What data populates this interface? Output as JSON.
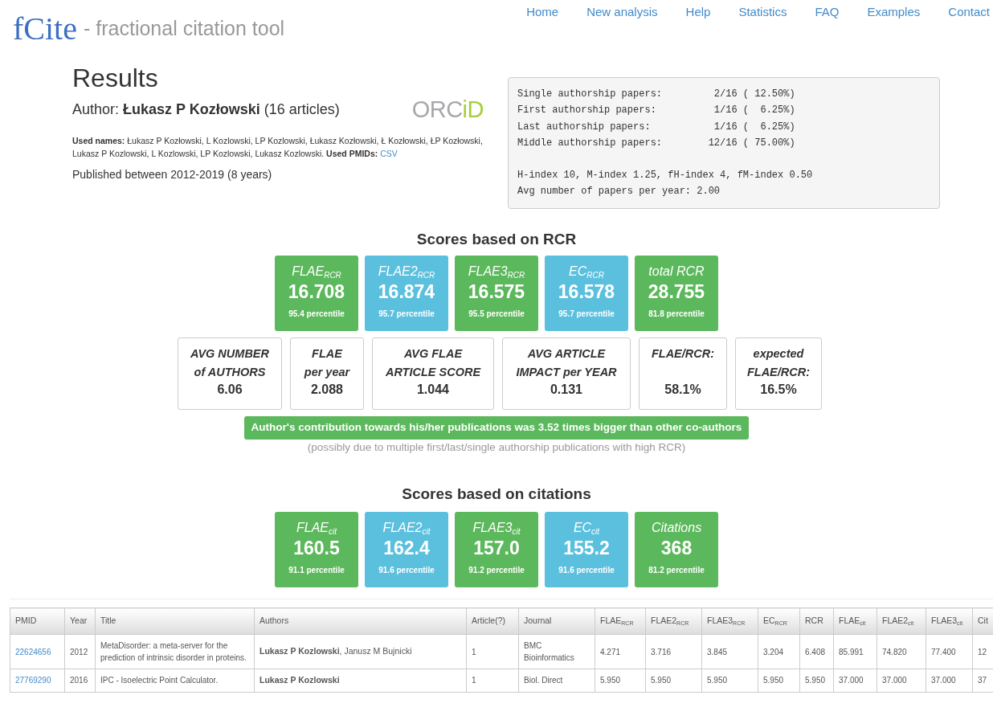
{
  "header": {
    "logo": "fCite",
    "tagline": "- fractional citation tool",
    "nav": [
      {
        "label": "Home"
      },
      {
        "label": "New analysis"
      },
      {
        "label": "Help"
      },
      {
        "label": "Statistics"
      },
      {
        "label": "FAQ"
      },
      {
        "label": "Examples"
      },
      {
        "label": "Contact"
      }
    ]
  },
  "results": {
    "title": "Results",
    "author": "Author: **Łukasz P Kozłowski** (16 articles)",
    "orcid": [
      "ORC",
      "iD"
    ],
    "used_names": "**Used names:** Łukasz P Kozłowski, L Kozlowski, LP Kozlowski, Łukasz Kozłowski, Ł Kozłowski, ŁP Kozłowski, Lukasz P Kozlowski, L Kozlowski, LP Kozlowski, Lukasz Kozlowski. **Used PMIDs:**",
    "csv_link": "CSV",
    "published": "Published between 2012-2019 (8 years)"
  },
  "stats_box": {
    "authorship": [
      "Single authorship papers:         2/16 ( 12.50%)",
      "First authorship papers:          1/16 (  6.25%)",
      "Last authorship papers:           1/16 (  6.25%)",
      "Middle authorship papers:        12/16 ( 75.00%)"
    ],
    "indices": [
      "H-index 10, M-index 1.25, fH-index 4, fM-index 0.50",
      "Avg number of papers per year: 2.00"
    ]
  },
  "rcr": {
    "heading": "Scores based on RCR",
    "tiles": [
      {
        "label": "FLAE$_{RCR}$",
        "value": "16.708",
        "percentile": "95.4 percentile",
        "color": "#5cb85c"
      },
      {
        "label": "FLAE2$_{RCR}$",
        "value": "16.874",
        "percentile": "95.7 percentile",
        "color": "#5bc0de"
      },
      {
        "label": "FLAE3$_{RCR}$",
        "value": "16.575",
        "percentile": "95.5 percentile",
        "color": "#5cb85c"
      },
      {
        "label": "EC$_{RCR}$",
        "value": "16.578",
        "percentile": "95.7 percentile",
        "color": "#5bc0de"
      },
      {
        "label": "total RCR",
        "value": "28.755",
        "percentile": "81.8 percentile",
        "color": "#5cb85c"
      }
    ],
    "metrics": [
      {
        "label": [
          "AVG NUMBER",
          "of AUTHORS"
        ],
        "value": "6.06"
      },
      {
        "label": [
          "FLAE",
          "per year"
        ],
        "value": "2.088"
      },
      {
        "label": [
          "AVG FLAE",
          "ARTICLE SCORE"
        ],
        "value": "1.044"
      },
      {
        "label": [
          "AVG ARTICLE",
          "IMPACT per YEAR"
        ],
        "value": "0.131"
      },
      {
        "label": [
          "FLAE/RCR:"
        ],
        "value": "58.1%"
      },
      {
        "label": [
          "expected",
          "FLAE/RCR:"
        ],
        "value": "16.5%"
      }
    ],
    "banner": "Author's contribution towards his/her publications was 3.52 times bigger than other co-authors",
    "note": "(possibly due to multiple first/last/single authorship publications with high RCR)"
  },
  "citations": {
    "heading": "Scores based on citations",
    "tiles": [
      {
        "label": "FLAE$_{cit}$",
        "value": "160.5",
        "percentile": "91.1 percentile",
        "color": "#5cb85c"
      },
      {
        "label": "FLAE2$_{cit}$",
        "value": "162.4",
        "percentile": "91.6 percentile",
        "color": "#5bc0de"
      },
      {
        "label": "FLAE3$_{cit}$",
        "value": "157.0",
        "percentile": "91.2 percentile",
        "color": "#5cb85c"
      },
      {
        "label": "EC$_{cit}$",
        "value": "155.2",
        "percentile": "91.6 percentile",
        "color": "#5bc0de"
      },
      {
        "label": "Citations",
        "value": "368",
        "percentile": "81.2 percentile",
        "color": "#5cb85c"
      }
    ]
  },
  "table": {
    "columns": [
      "PMID",
      "Year",
      "Title",
      "Authors",
      "Article(?)",
      "Journal",
      "FLAE$_{RCR}$",
      "FLAE2$_{RCR}$",
      "FLAE3$_{RCR}$",
      "EC$_{RCR}$",
      "RCR",
      "FLAE$_{cit}$",
      "FLAE2$_{cit}$",
      "FLAE3$_{cit}$",
      "Cit"
    ],
    "rows": [
      [
        "22624656",
        "2012",
        "MetaDisorder: a meta-server for the prediction of intrinsic disorder in proteins.",
        "**Lukasz P Kozlowski**, Janusz M Bujnicki",
        "1",
        "BMC Bioinformatics",
        "4.271",
        "3.716",
        "3.845",
        "3.204",
        "6.408",
        "85.991",
        "74.820",
        "77.400",
        "12"
      ],
      [
        "27769290",
        "2016",
        "IPC - Isoelectric Point Calculator.",
        "**Lukasz P Kozlowski**",
        "1",
        "Biol. Direct",
        "5.950",
        "5.950",
        "5.950",
        "5.950",
        "5.950",
        "37.000",
        "37.000",
        "37.000",
        "37"
      ]
    ]
  }
}
